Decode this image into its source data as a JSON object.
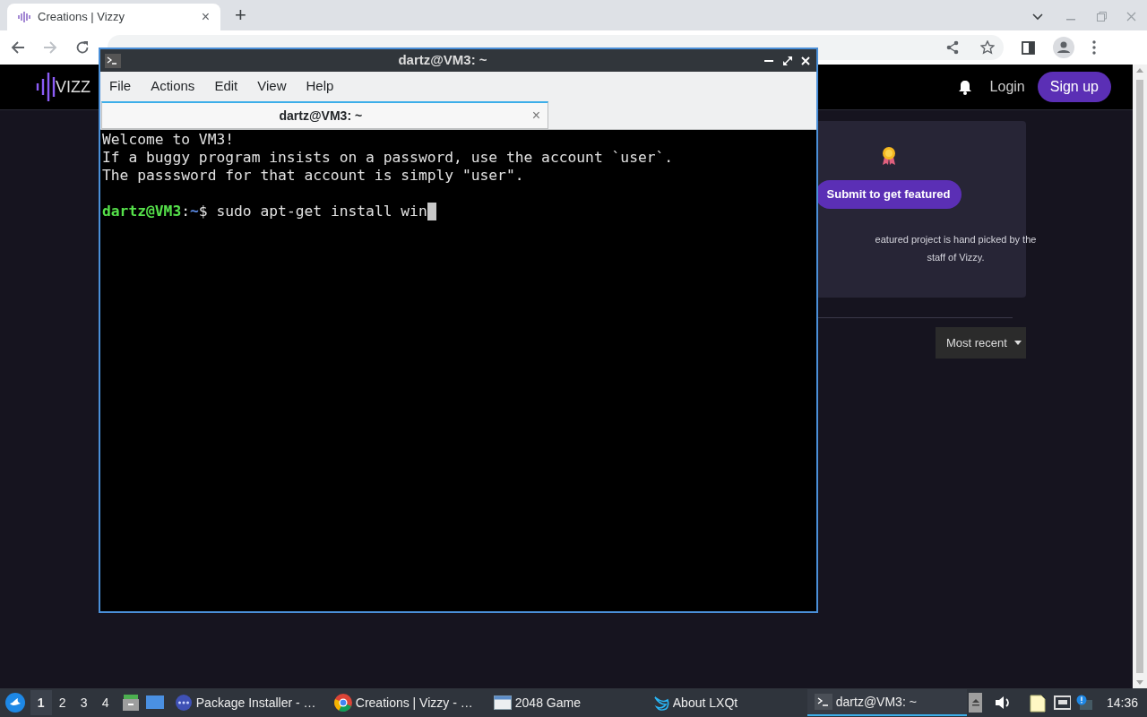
{
  "browser": {
    "tabs": [
      {
        "title": "Creations | Vizzy",
        "close": "×",
        "selected": true
      }
    ],
    "new_tab": "+"
  },
  "site": {
    "logo": "VIZZ",
    "login": "Login",
    "signup": "Sign up",
    "featured_card": {
      "button": "Submit to get featured",
      "description": "eatured project is hand picked by the staff of Vizzy."
    },
    "sort": {
      "label": "Most recent"
    }
  },
  "terminal": {
    "title": "dartz@VM3: ~",
    "menu": [
      "File",
      "Actions",
      "Edit",
      "View",
      "Help"
    ],
    "tabs": [
      {
        "label": "dartz@VM3: ~",
        "close": "×",
        "selected": true
      }
    ],
    "lines": [
      "Welcome to VM3!",
      "If a buggy program insists on a password, use the account `user`.",
      "The passsword for that account is simply \"user\"."
    ],
    "prompt": {
      "user_host": "dartz@VM3",
      "separator": ":",
      "path": "~",
      "symbol": "$",
      "command": "sudo apt-get install win"
    }
  },
  "taskbar": {
    "desktops": [
      {
        "label": "1",
        "selected": true
      },
      {
        "label": "2",
        "selected": false
      },
      {
        "label": "3",
        "selected": false
      },
      {
        "label": "4",
        "selected": false
      }
    ],
    "windows": [
      {
        "label": "Package Installer - …",
        "kind": "package",
        "selected": false
      },
      {
        "label": "Creations | Vizzy - …",
        "kind": "browser",
        "selected": false
      },
      {
        "label": "2048 Game",
        "kind": "window",
        "selected": false
      },
      {
        "label": "About LXQt",
        "kind": "bird",
        "selected": false
      },
      {
        "label": "dartz@VM3: ~",
        "kind": "terminal",
        "selected": true
      }
    ],
    "clock": "14:36"
  }
}
